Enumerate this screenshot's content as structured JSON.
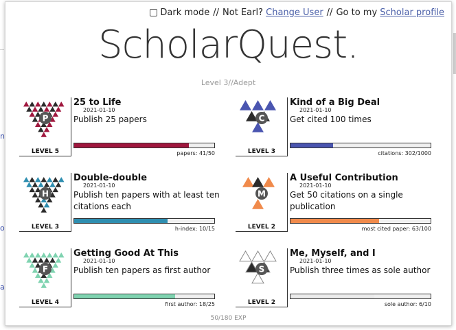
{
  "header": {
    "dark_mode_label": "Dark mode",
    "sep": "//",
    "not_user_text": "Not Earl?",
    "change_user_label": "Change User",
    "goto_text": "Go to my",
    "scholar_profile_label": "Scholar profile"
  },
  "logo": {
    "main": "ScholarQuest",
    "dot": "."
  },
  "level_line": "Level 3//Adept",
  "exp_line": "50/180 EXP",
  "achievements": [
    {
      "title": "25 to Life",
      "date": "2021-01-10",
      "description": "Publish 25 papers",
      "level": "LEVEL 5",
      "letter": "P",
      "color": "#a0173e",
      "progress_label": "papers: 41/50",
      "progress": 0.82
    },
    {
      "title": "Kind of a Big Deal",
      "date": "2021-01-10",
      "description": "Get cited 100 times",
      "level": "LEVEL 3",
      "letter": "C",
      "color": "#4a55b0",
      "progress_label": "citations: 302/1000",
      "progress": 0.302
    },
    {
      "title": "Double-double",
      "date": "2021-01-10",
      "description": "Publish ten papers with at least ten citations each",
      "level": "LEVEL 3",
      "letter": "H",
      "color": "#2e8eb0",
      "progress_label": "h-index: 10/15",
      "progress": 0.667
    },
    {
      "title": "A Useful Contribution",
      "date": "2021-01-10",
      "description": "Get 50 citations on a single publication",
      "level": "LEVEL 2",
      "letter": "M",
      "color": "#f08a4b",
      "progress_label": "most cited paper: 63/100",
      "progress": 0.63
    },
    {
      "title": "Getting Good At This",
      "date": "2021-01-10",
      "description": "Publish ten papers as first author",
      "level": "LEVEL 4",
      "letter": "F",
      "color": "#7fd3b0",
      "progress_label": "first author: 18/25",
      "progress": 0.72
    },
    {
      "title": "Me, Myself, and I",
      "date": "2021-01-10",
      "description": "Publish three times as sole author",
      "level": "LEVEL 2",
      "letter": "S",
      "color": "#ececec",
      "progress_label": "sole author: 6/10",
      "progress": 0.6
    }
  ]
}
